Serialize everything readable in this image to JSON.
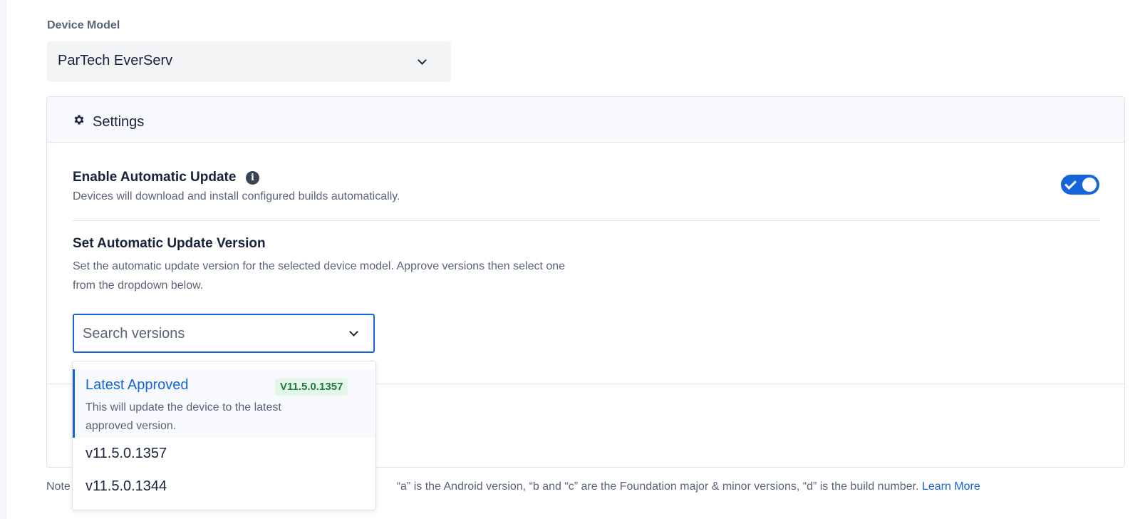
{
  "device_model": {
    "label": "Device Model",
    "selected": "ParTech EverServ"
  },
  "settings": {
    "title": "Settings",
    "auto_update": {
      "title": "Enable Automatic Update",
      "info_icon": "info-icon",
      "description": "Devices will download and install configured builds automatically.",
      "enabled": true
    },
    "version": {
      "title": "Set Automatic Update Version",
      "description": "Set the automatic update version for the selected device model. Approve versions then select one from the dropdown below.",
      "search_placeholder": "Search versions"
    }
  },
  "dropdown": {
    "latest": {
      "title": "Latest Approved",
      "badge": "V11.5.0.1357",
      "description": "This will update the device to the latest approved version."
    },
    "options": [
      "v11.5.0.1357",
      "v11.5.0.1344"
    ]
  },
  "note": {
    "prefix": "Note",
    "text": "“a” is the Android version, “b and “c” are the Foundation major & minor versions, “d” is the build number.",
    "link": "Learn More"
  },
  "colors": {
    "accent": "#1565d8",
    "badge_bg": "#e4f5ea",
    "badge_text": "#1e7a3c"
  }
}
